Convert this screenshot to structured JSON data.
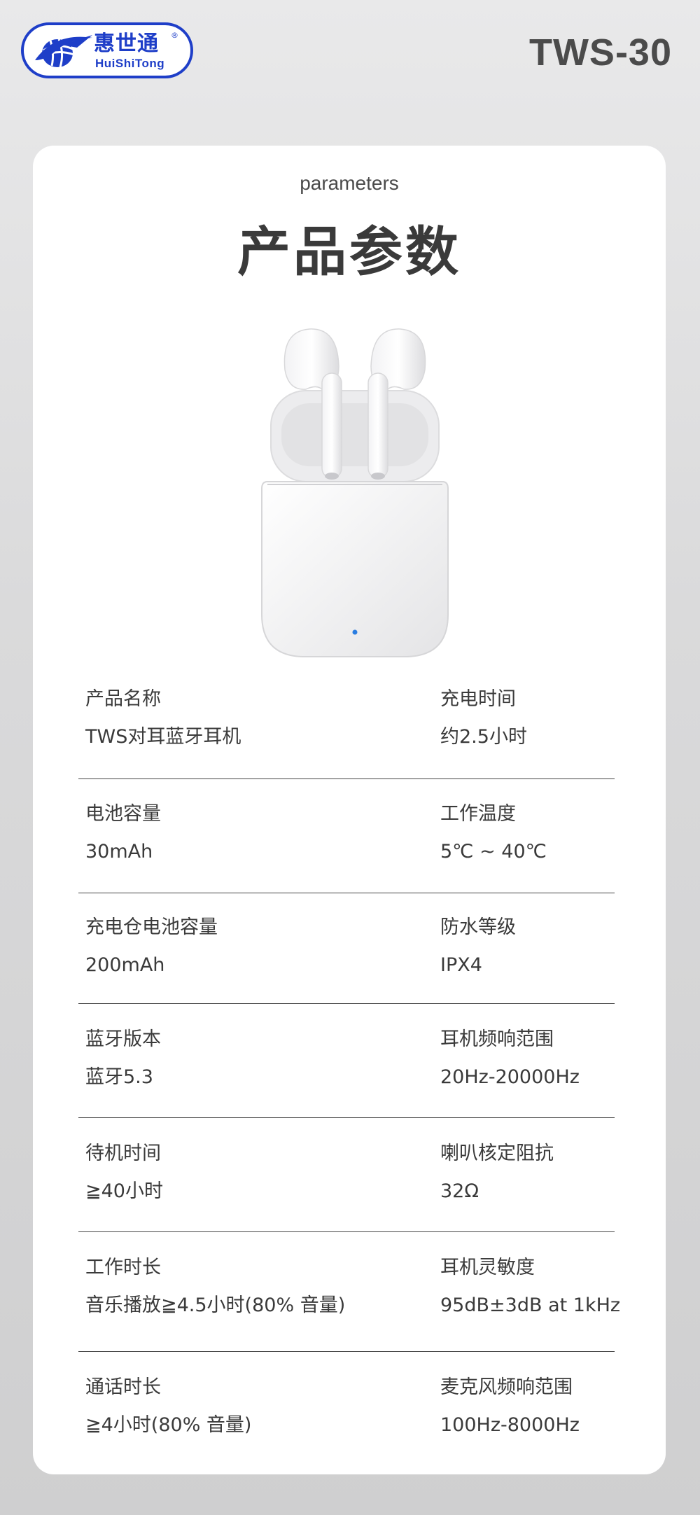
{
  "header": {
    "logo_cn": "惠世通",
    "logo_en": "HuiShiTong",
    "logo_reg": "®",
    "model": "TWS-30"
  },
  "card": {
    "subtitle": "parameters",
    "title": "产品参数"
  },
  "specs": [
    {
      "left": {
        "label": "产品名称",
        "value": "TWS对耳蓝牙耳机"
      },
      "right": {
        "label": "充电时间",
        "value": "约2.5小时"
      }
    },
    {
      "left": {
        "label": "电池容量",
        "value": "30mAh"
      },
      "right": {
        "label": "工作温度",
        "value": "5℃ ~ 40℃"
      }
    },
    {
      "left": {
        "label": "充电仓电池容量",
        "value": "200mAh"
      },
      "right": {
        "label": "防水等级",
        "value": "IPX4"
      }
    },
    {
      "left": {
        "label": "蓝牙版本",
        "value": "蓝牙5.3"
      },
      "right": {
        "label": "耳机频响范围",
        "value": "20Hz-20000Hz"
      }
    },
    {
      "left": {
        "label": "待机时间",
        "value": "≧40小时"
      },
      "right": {
        "label": "喇叭核定阻抗",
        "value": "32Ω"
      }
    },
    {
      "left": {
        "label": "工作时长",
        "value": "音乐播放≧4.5小时(80% 音量)"
      },
      "right": {
        "label": "耳机灵敏度",
        "value": "95dB±3dB at 1kHz"
      }
    },
    {
      "left": {
        "label": "通话时长",
        "value": "≧4小时(80% 音量)"
      },
      "right": {
        "label": "麦克风频响范围",
        "value": "100Hz-8000Hz"
      }
    }
  ],
  "colors": {
    "brand": "#1e3ec8",
    "text": "#3a3a3a",
    "led": "#2a7de1"
  }
}
